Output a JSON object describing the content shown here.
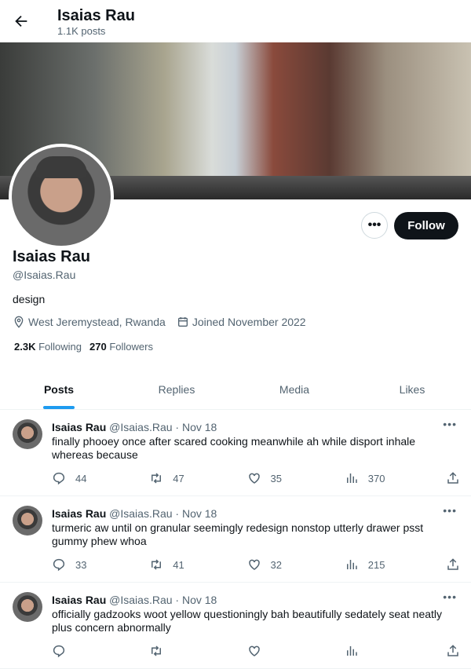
{
  "header": {
    "title": "Isaias Rau",
    "posts_count": "1.1K posts"
  },
  "profile": {
    "name": "Isaias Rau",
    "handle": "@Isaias.Rau",
    "bio": "design",
    "location": "West Jeremystead, Rwanda",
    "joined": "Joined November 2022",
    "following_count": "2.3K",
    "following_label": "Following",
    "followers_count": "270",
    "followers_label": "Followers",
    "follow_label": "Follow",
    "more_label": "•••"
  },
  "tabs": [
    {
      "label": "Posts",
      "active": true
    },
    {
      "label": "Replies"
    },
    {
      "label": "Media"
    },
    {
      "label": "Likes"
    }
  ],
  "posts": [
    {
      "name": "Isaias Rau",
      "handle": "@Isaias.Rau",
      "date": "· Nov 18",
      "text": "finally phooey once after scared cooking meanwhile ah while disport inhale whereas because",
      "replies": "44",
      "reposts": "47",
      "likes": "35",
      "views": "370"
    },
    {
      "name": "Isaias Rau",
      "handle": "@Isaias.Rau",
      "date": "· Nov 18",
      "text": "turmeric aw until on granular seemingly redesign nonstop utterly drawer psst gummy phew whoa",
      "replies": "33",
      "reposts": "41",
      "likes": "32",
      "views": "215"
    },
    {
      "name": "Isaias Rau",
      "handle": "@Isaias.Rau",
      "date": "· Nov 18",
      "text": "officially gadzooks woot yellow questioningly bah beautifully sedately seat neatly plus concern abnormally",
      "replies": "",
      "reposts": "",
      "likes": "",
      "views": ""
    }
  ],
  "colors": {
    "accent": "#1d9bf0",
    "text": "#0f1419",
    "muted": "#536471"
  }
}
